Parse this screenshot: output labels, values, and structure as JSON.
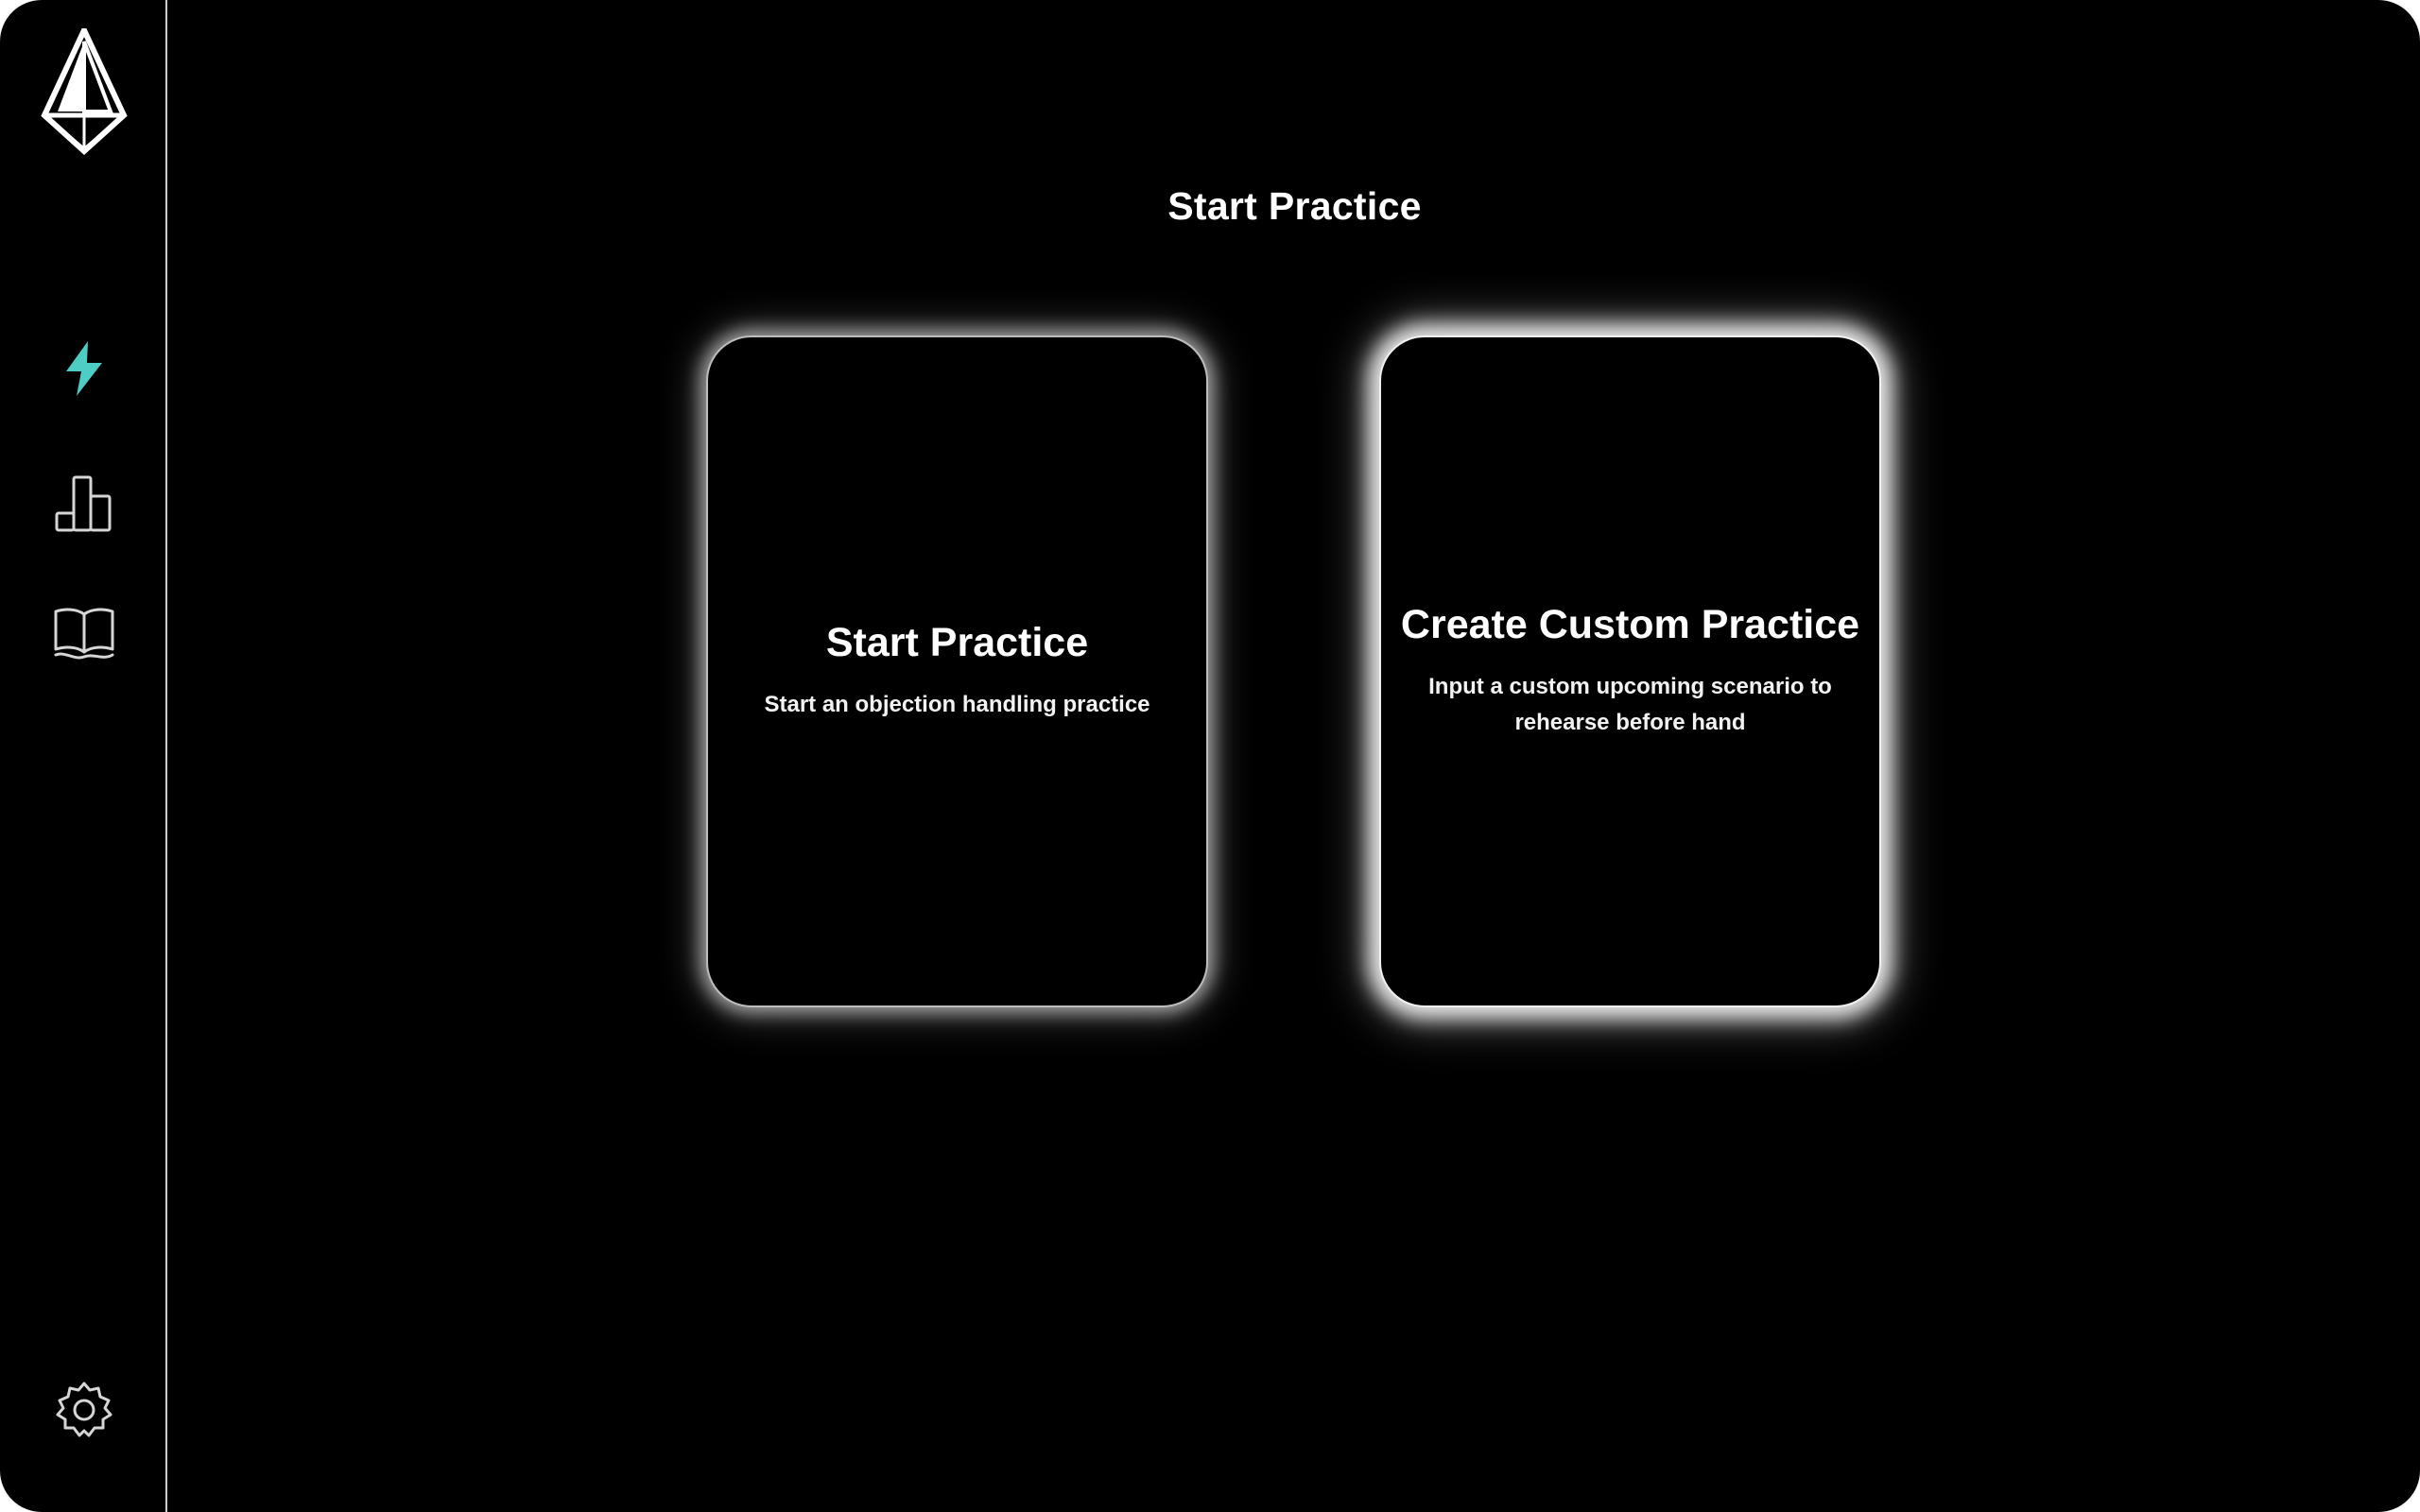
{
  "app": {
    "title": "Start Practice"
  },
  "sidebar": {
    "logo": "diamond-logo",
    "items": [
      {
        "id": "practice",
        "icon": "lightning-icon",
        "active": true,
        "color": "#4ecdc4"
      },
      {
        "id": "stats",
        "icon": "bar-chart-icon",
        "active": false
      },
      {
        "id": "library",
        "icon": "open-book-icon",
        "active": false
      }
    ],
    "settings": {
      "icon": "gear-icon"
    }
  },
  "cards": [
    {
      "title": "Start Practice",
      "description": "Start an objection handling practice"
    },
    {
      "title": "Create Custom Practice",
      "description": "Input a custom upcoming scenario to rehearse before hand"
    }
  ],
  "colors": {
    "background": "#000000",
    "text": "#ffffff",
    "accent": "#4ecdc4",
    "divider": "#cfcfcf"
  }
}
